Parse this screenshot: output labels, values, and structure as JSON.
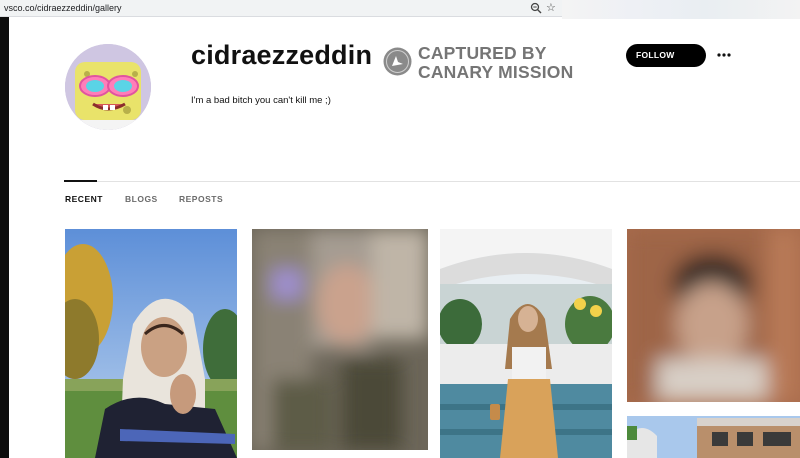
{
  "browser": {
    "url": "vsco.co/cidraezzeddin/gallery",
    "icons": [
      "zoom-icon",
      "star-icon"
    ]
  },
  "profile": {
    "username": "cidraezzeddin",
    "bio": "I'm a bad bitch you can't kill me ;)",
    "follow_label": "FOLLOW",
    "watermark_line1": "CAPTURED BY",
    "watermark_line2": "CANARY MISSION"
  },
  "tabs": [
    {
      "label": "RECENT",
      "active": true
    },
    {
      "label": "BLOGS",
      "active": false
    },
    {
      "label": "REPOSTS",
      "active": false
    }
  ],
  "gallery": {
    "photos": [
      {
        "name": "photo-woman-hijab-outdoors",
        "blurred": false
      },
      {
        "name": "photo-blurred-1",
        "blurred": true
      },
      {
        "name": "photo-woman-hijab-garden",
        "blurred": false
      },
      {
        "name": "photo-blurred-2",
        "blurred": true
      },
      {
        "name": "photo-building",
        "blurred": false
      }
    ]
  },
  "colors": {
    "follow_bg": "#000000",
    "watermark_gray": "#757575",
    "tab_inactive": "#6b6b6b"
  }
}
